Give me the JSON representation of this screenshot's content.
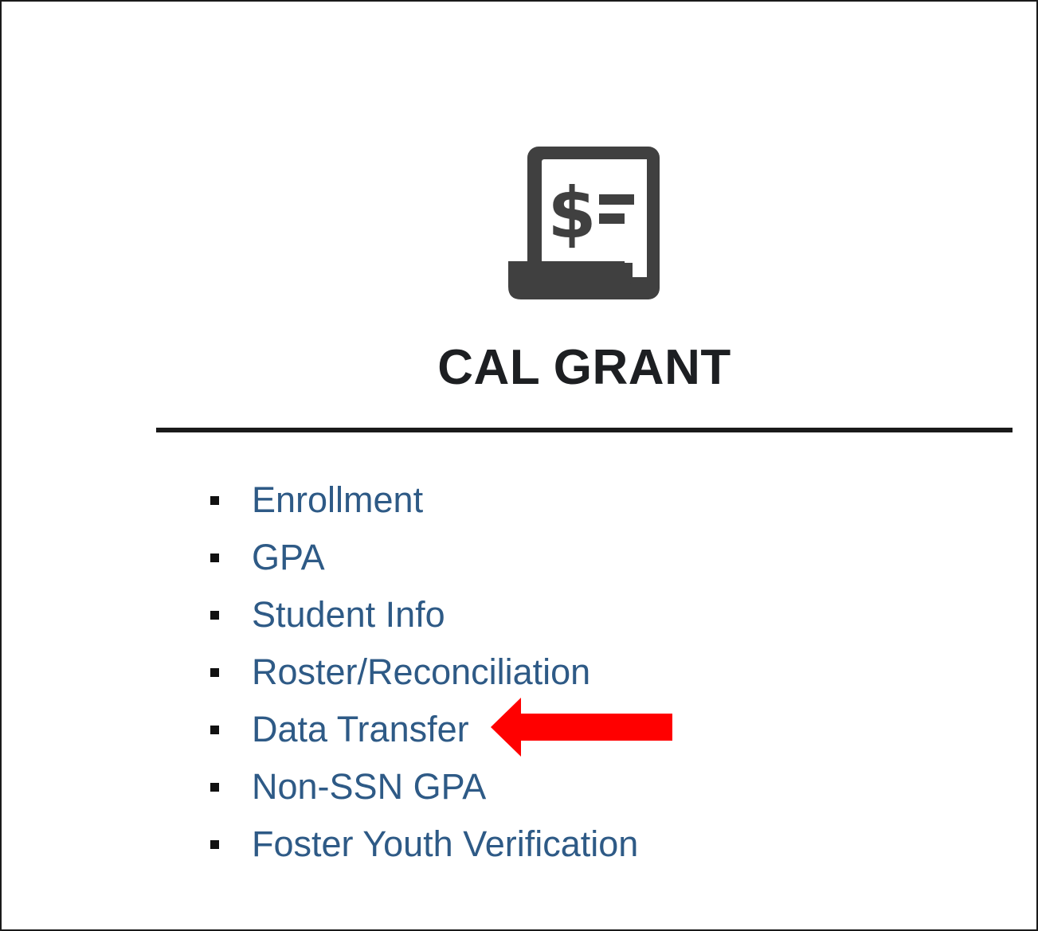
{
  "section": {
    "title": "CAL GRANT",
    "icon": "receipt-dollar-icon",
    "icon_glyph": "$"
  },
  "menu": {
    "items": [
      {
        "label": "Enrollment",
        "name": "enrollment"
      },
      {
        "label": "GPA",
        "name": "gpa"
      },
      {
        "label": "Student Info",
        "name": "student-info"
      },
      {
        "label": "Roster/Reconciliation",
        "name": "roster-reconciliation"
      },
      {
        "label": "Data Transfer",
        "name": "data-transfer"
      },
      {
        "label": "Non-SSN GPA",
        "name": "non-ssn-gpa"
      },
      {
        "label": "Foster Youth Verification",
        "name": "foster-youth-verification"
      }
    ]
  },
  "annotation": {
    "icon": "arrow-left-icon",
    "color": "#ff0000",
    "points_to": "Data Transfer"
  },
  "colors": {
    "link": "#2e5a86",
    "icon": "#404040",
    "title": "#1d1f22"
  }
}
